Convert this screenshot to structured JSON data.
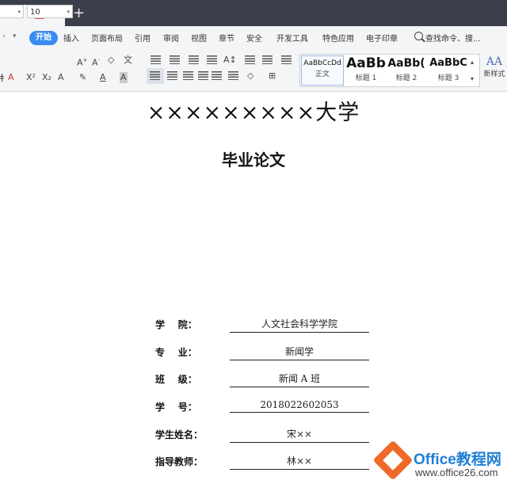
{
  "menu": {
    "start": "开始",
    "items": [
      "插入",
      "页面布局",
      "引用",
      "审阅",
      "视图",
      "章节",
      "安全",
      "开发工具",
      "特色应用",
      "电子印章"
    ],
    "search": "查找命令、搜..."
  },
  "toolbar": {
    "font_size": "10",
    "styles": [
      {
        "sample": "AaBbCcDd",
        "label": "正文"
      },
      {
        "sample": "AaBb",
        "label": "标题 1"
      },
      {
        "sample": "AaBb(",
        "label": "标题 2"
      },
      {
        "sample": "AaBbC",
        "label": "标题 3"
      }
    ],
    "new_style": "新样式",
    "new_style_icon_text": "AA"
  },
  "document": {
    "university": "×××××××××大学",
    "thesis_title": "毕业论文",
    "fields": [
      {
        "label": "学    院：",
        "value": "人文社会科学学院"
      },
      {
        "label": "专    业：",
        "value": "新闻学"
      },
      {
        "label": "班    级：",
        "value": "新闻 A 班"
      },
      {
        "label": "学    号：",
        "value": "2018022602053"
      },
      {
        "label": "学生姓名：",
        "value": "宋××"
      },
      {
        "label": "指导教师：",
        "value": "林××"
      }
    ]
  },
  "watermark": {
    "brand": "Office教程网",
    "url": "www.office26.com"
  },
  "colors": {
    "accent": "#3c8cf0",
    "titlebar": "#3a3f4b",
    "logo_orange": "#ef6a2a",
    "logo_blue": "#1f7fd6"
  }
}
